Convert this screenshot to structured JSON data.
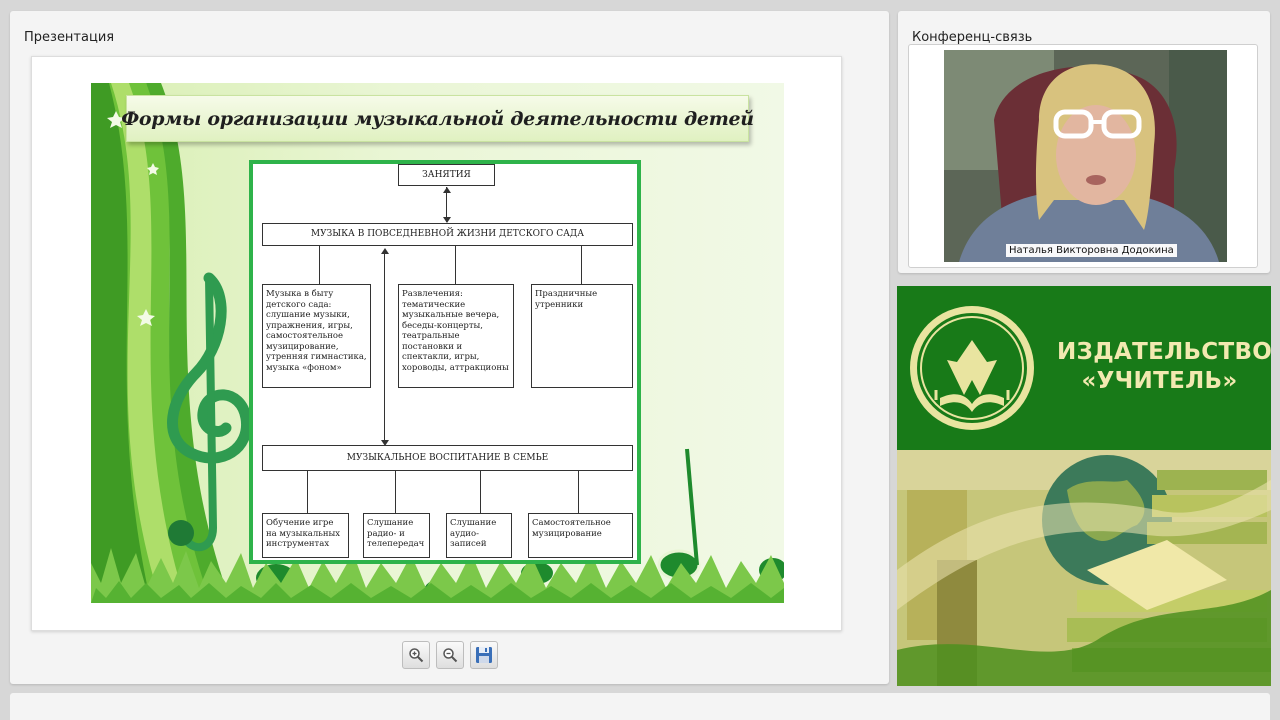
{
  "presentation_panel": {
    "title": "Презентация",
    "slide": {
      "title": "Формы организации музыкальной деятельности детей",
      "diagram": {
        "top_box": "ЗАНЯТИЯ",
        "middle_box": "МУЗЫКА В ПОВСЕДНЕВНОЙ ЖИЗНИ ДЕТСКОГО САДА",
        "columns": [
          "Музыка в быту детского сада: слушание музыки, упражнения, игры, самостоятельное музицирование, утренняя гимнастика, музыка «фоном»",
          "Развлечения: тематические музыкальные вечера, беседы-концерты, театральные постановки и спектакли, игры, хороводы, аттракционы",
          "Праздничные утренники"
        ],
        "family_box": "МУЗЫКАЛЬНОЕ ВОСПИТАНИЕ В СЕМЬЕ",
        "family_columns": [
          "Обучение игре на музыкальных инструментах",
          "Слушание радио- и телепередач",
          "Слушание аудио-записей",
          "Самостоятельное музицирование"
        ]
      }
    },
    "toolbar": {
      "zoom_in_icon": "zoom-in-icon",
      "zoom_out_icon": "zoom-out-icon",
      "save_icon": "floppy-disk-icon"
    }
  },
  "conference_panel": {
    "title": "Конференц-связь",
    "participant_name": "Наталья Викторовна Додокина"
  },
  "publisher": {
    "name_line1": "ИЗДАТЕЛЬСТВО",
    "name_line2": "«УЧИТЕЛЬ»",
    "colors": {
      "background": "#187a18",
      "text": "#f2e9b0"
    }
  }
}
